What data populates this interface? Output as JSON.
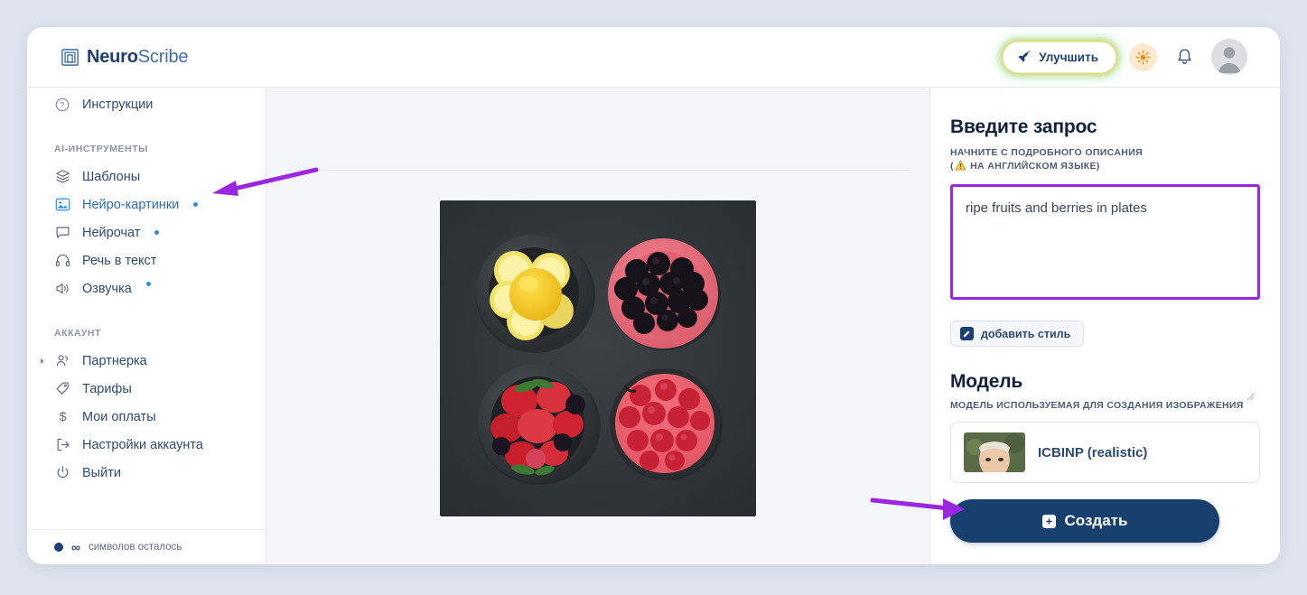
{
  "app": {
    "brand_bold": "Neuro",
    "brand_light": "Scribe",
    "logo_icon": "nested-squares-logo"
  },
  "header": {
    "upgrade_label": "Улучшить",
    "upgrade_icon": "rocket-icon",
    "theme_icon": "sun-icon",
    "notifications_icon": "bell-icon",
    "avatar_icon": "user-avatar",
    "accent_glow_yellow": "#ffc43c",
    "accent_glow_green": "#50dc78"
  },
  "sidebar": {
    "top_items": [
      {
        "label": "Инструкции",
        "icon": "question-circle-icon"
      }
    ],
    "sections": [
      {
        "title": "AI-ИНСТРУМЕНТЫ",
        "items": [
          {
            "label": "Шаблоны",
            "icon": "layers-icon",
            "badge": false,
            "active": false
          },
          {
            "label": "Нейро-картинки",
            "icon": "image-icon",
            "badge": true,
            "active": true
          },
          {
            "label": "Нейрочат",
            "icon": "chat-bubble-icon",
            "badge": true,
            "active": false
          },
          {
            "label": "Речь в текст",
            "icon": "headphones-icon",
            "badge": false,
            "active": false
          },
          {
            "label": "Озвучка",
            "icon": "speaker-icon",
            "badge": true,
            "active": false
          }
        ]
      },
      {
        "title": "АККАУНТ",
        "items": [
          {
            "label": "Партнерка",
            "icon": "people-icon",
            "badge": false,
            "active": false,
            "expandable": true
          },
          {
            "label": "Тарифы",
            "icon": "tag-icon",
            "badge": false,
            "active": false
          },
          {
            "label": "Мои оплаты",
            "icon": "dollar-icon",
            "badge": false,
            "active": false
          },
          {
            "label": "Настройки аккаунта",
            "icon": "logout-arrow-icon",
            "badge": false,
            "active": false
          },
          {
            "label": "Выйти",
            "icon": "power-icon",
            "badge": false,
            "active": false
          }
        ]
      }
    ],
    "footer": {
      "symbol": "∞",
      "label": "символов осталось",
      "dot_icon": "status-dot"
    }
  },
  "center": {
    "generated_image_alt": "ripe fruits and berries in four plates on dark background"
  },
  "right_panel": {
    "prompt_title": "Введите запрос",
    "prompt_hint_line1": "НАЧНИТЕ С ПОДРОБНОГО ОПИСАНИЯ",
    "prompt_hint_line2_prefix": "(",
    "prompt_hint_line2": " НА АНГЛИЙСКОМ ЯЗЫКЕ)",
    "prompt_hint_icon": "warning-triangle-icon",
    "prompt_value": "ripe fruits and berries in plates",
    "prompt_placeholder": "",
    "prompt_border_color": "#9b26e0",
    "add_style_label": "добавить стиль",
    "add_style_icon": "pencil-square-icon",
    "model_title": "Модель",
    "model_sub": "МОДЕЛЬ ИСПОЛЬЗУЕМАЯ ДЛЯ СОЗДАНИЯ ИЗОБРАЖЕНИЯ",
    "model_selected": "ICBINP (realistic)",
    "model_thumb_icon": "model-preview-thumbnail",
    "create_label": "Создать",
    "create_icon": "plus-square-icon",
    "create_color": "#17406f"
  },
  "annotations": {
    "arrow_color": "#9b26e0",
    "arrow_sidebar_target": "Нейро-картинки",
    "arrow_create_target": "Создать"
  }
}
